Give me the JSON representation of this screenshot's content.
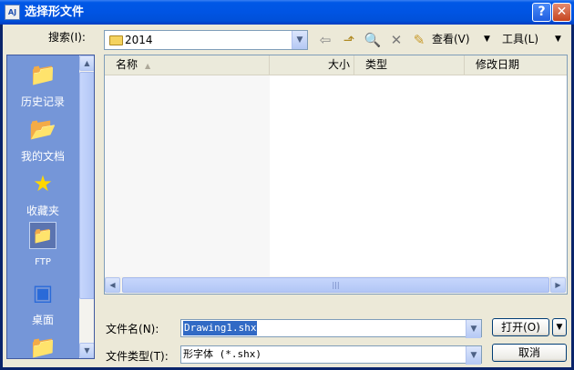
{
  "window": {
    "title": "选择形文件",
    "help_label": "?",
    "close_label": "✕"
  },
  "lookin": {
    "label": "搜索(I):",
    "label_main": "搜索",
    "label_key": "(I)",
    "label_colon": ":",
    "value": "2014"
  },
  "toolbar": {
    "back_icon": "back-arrow-icon",
    "up_icon": "up-folder-icon",
    "search_icon": "search-web-icon",
    "delete_icon": "delete-icon",
    "newfolder_icon": "new-folder-icon",
    "view_label": "查看(V)",
    "tools_label": "工具(L)"
  },
  "places": [
    {
      "label": "历史记录",
      "icon": "history-folder-icon"
    },
    {
      "label": "我的文档",
      "icon": "my-documents-icon"
    },
    {
      "label": "收藏夹",
      "icon": "favorites-star-icon"
    },
    {
      "label": "FTP",
      "icon": "ftp-icon"
    },
    {
      "label": "桌面",
      "icon": "desktop-icon"
    }
  ],
  "filelist": {
    "columns": [
      {
        "label": "名称"
      },
      {
        "label": "大小"
      },
      {
        "label": "类型"
      },
      {
        "label": "修改日期"
      }
    ]
  },
  "filename": {
    "label_main": "文件名",
    "label_key": "(N)",
    "label_colon": ":",
    "value": "Drawing1.shx"
  },
  "filetype": {
    "label_main": "文件类型",
    "label_key": "(T)",
    "label_colon": ":",
    "value": "形字体 (*.shx)"
  },
  "buttons": {
    "open_label": "打开(O)",
    "cancel_label": "取消"
  }
}
